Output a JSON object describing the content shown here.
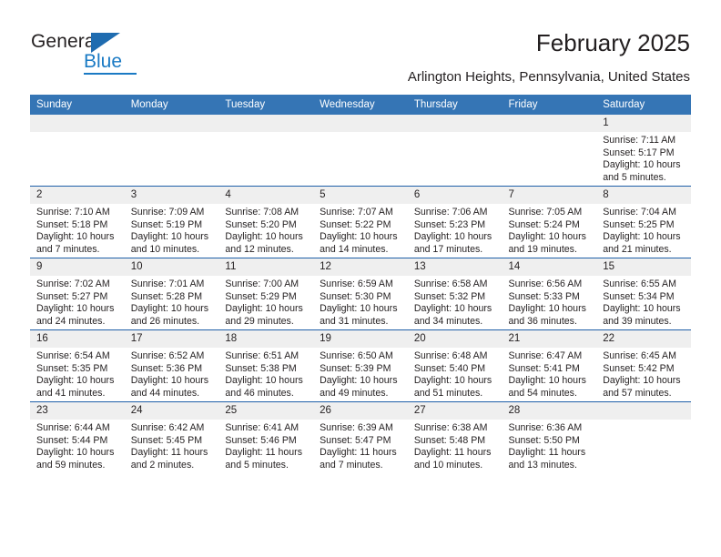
{
  "brand": {
    "name_part1": "General",
    "name_part2": "Blue",
    "triangle_color": "#1f6cb0",
    "blue_color": "#1a7ac4"
  },
  "header": {
    "title": "February 2025",
    "subtitle": "Arlington Heights, Pennsylvania, United States",
    "header_bg": "#3575b5",
    "row_line": "#1f5fa8",
    "daynum_bg": "#efefef"
  },
  "weekday_headers": [
    "Sunday",
    "Monday",
    "Tuesday",
    "Wednesday",
    "Thursday",
    "Friday",
    "Saturday"
  ],
  "labels": {
    "sunrise": "Sunrise:",
    "sunset": "Sunset:",
    "daylight": "Daylight:"
  },
  "weeks": [
    [
      {
        "day": "",
        "blank": true
      },
      {
        "day": "",
        "blank": true
      },
      {
        "day": "",
        "blank": true
      },
      {
        "day": "",
        "blank": true
      },
      {
        "day": "",
        "blank": true
      },
      {
        "day": "",
        "blank": true
      },
      {
        "day": "1",
        "sunrise": "Sunrise: 7:11 AM",
        "sunset": "Sunset: 5:17 PM",
        "daylight1": "Daylight: 10 hours",
        "daylight2": "and 5 minutes."
      }
    ],
    [
      {
        "day": "2",
        "sunrise": "Sunrise: 7:10 AM",
        "sunset": "Sunset: 5:18 PM",
        "daylight1": "Daylight: 10 hours",
        "daylight2": "and 7 minutes."
      },
      {
        "day": "3",
        "sunrise": "Sunrise: 7:09 AM",
        "sunset": "Sunset: 5:19 PM",
        "daylight1": "Daylight: 10 hours",
        "daylight2": "and 10 minutes."
      },
      {
        "day": "4",
        "sunrise": "Sunrise: 7:08 AM",
        "sunset": "Sunset: 5:20 PM",
        "daylight1": "Daylight: 10 hours",
        "daylight2": "and 12 minutes."
      },
      {
        "day": "5",
        "sunrise": "Sunrise: 7:07 AM",
        "sunset": "Sunset: 5:22 PM",
        "daylight1": "Daylight: 10 hours",
        "daylight2": "and 14 minutes."
      },
      {
        "day": "6",
        "sunrise": "Sunrise: 7:06 AM",
        "sunset": "Sunset: 5:23 PM",
        "daylight1": "Daylight: 10 hours",
        "daylight2": "and 17 minutes."
      },
      {
        "day": "7",
        "sunrise": "Sunrise: 7:05 AM",
        "sunset": "Sunset: 5:24 PM",
        "daylight1": "Daylight: 10 hours",
        "daylight2": "and 19 minutes."
      },
      {
        "day": "8",
        "sunrise": "Sunrise: 7:04 AM",
        "sunset": "Sunset: 5:25 PM",
        "daylight1": "Daylight: 10 hours",
        "daylight2": "and 21 minutes."
      }
    ],
    [
      {
        "day": "9",
        "sunrise": "Sunrise: 7:02 AM",
        "sunset": "Sunset: 5:27 PM",
        "daylight1": "Daylight: 10 hours",
        "daylight2": "and 24 minutes."
      },
      {
        "day": "10",
        "sunrise": "Sunrise: 7:01 AM",
        "sunset": "Sunset: 5:28 PM",
        "daylight1": "Daylight: 10 hours",
        "daylight2": "and 26 minutes."
      },
      {
        "day": "11",
        "sunrise": "Sunrise: 7:00 AM",
        "sunset": "Sunset: 5:29 PM",
        "daylight1": "Daylight: 10 hours",
        "daylight2": "and 29 minutes."
      },
      {
        "day": "12",
        "sunrise": "Sunrise: 6:59 AM",
        "sunset": "Sunset: 5:30 PM",
        "daylight1": "Daylight: 10 hours",
        "daylight2": "and 31 minutes."
      },
      {
        "day": "13",
        "sunrise": "Sunrise: 6:58 AM",
        "sunset": "Sunset: 5:32 PM",
        "daylight1": "Daylight: 10 hours",
        "daylight2": "and 34 minutes."
      },
      {
        "day": "14",
        "sunrise": "Sunrise: 6:56 AM",
        "sunset": "Sunset: 5:33 PM",
        "daylight1": "Daylight: 10 hours",
        "daylight2": "and 36 minutes."
      },
      {
        "day": "15",
        "sunrise": "Sunrise: 6:55 AM",
        "sunset": "Sunset: 5:34 PM",
        "daylight1": "Daylight: 10 hours",
        "daylight2": "and 39 minutes."
      }
    ],
    [
      {
        "day": "16",
        "sunrise": "Sunrise: 6:54 AM",
        "sunset": "Sunset: 5:35 PM",
        "daylight1": "Daylight: 10 hours",
        "daylight2": "and 41 minutes."
      },
      {
        "day": "17",
        "sunrise": "Sunrise: 6:52 AM",
        "sunset": "Sunset: 5:36 PM",
        "daylight1": "Daylight: 10 hours",
        "daylight2": "and 44 minutes."
      },
      {
        "day": "18",
        "sunrise": "Sunrise: 6:51 AM",
        "sunset": "Sunset: 5:38 PM",
        "daylight1": "Daylight: 10 hours",
        "daylight2": "and 46 minutes."
      },
      {
        "day": "19",
        "sunrise": "Sunrise: 6:50 AM",
        "sunset": "Sunset: 5:39 PM",
        "daylight1": "Daylight: 10 hours",
        "daylight2": "and 49 minutes."
      },
      {
        "day": "20",
        "sunrise": "Sunrise: 6:48 AM",
        "sunset": "Sunset: 5:40 PM",
        "daylight1": "Daylight: 10 hours",
        "daylight2": "and 51 minutes."
      },
      {
        "day": "21",
        "sunrise": "Sunrise: 6:47 AM",
        "sunset": "Sunset: 5:41 PM",
        "daylight1": "Daylight: 10 hours",
        "daylight2": "and 54 minutes."
      },
      {
        "day": "22",
        "sunrise": "Sunrise: 6:45 AM",
        "sunset": "Sunset: 5:42 PM",
        "daylight1": "Daylight: 10 hours",
        "daylight2": "and 57 minutes."
      }
    ],
    [
      {
        "day": "23",
        "sunrise": "Sunrise: 6:44 AM",
        "sunset": "Sunset: 5:44 PM",
        "daylight1": "Daylight: 10 hours",
        "daylight2": "and 59 minutes."
      },
      {
        "day": "24",
        "sunrise": "Sunrise: 6:42 AM",
        "sunset": "Sunset: 5:45 PM",
        "daylight1": "Daylight: 11 hours",
        "daylight2": "and 2 minutes."
      },
      {
        "day": "25",
        "sunrise": "Sunrise: 6:41 AM",
        "sunset": "Sunset: 5:46 PM",
        "daylight1": "Daylight: 11 hours",
        "daylight2": "and 5 minutes."
      },
      {
        "day": "26",
        "sunrise": "Sunrise: 6:39 AM",
        "sunset": "Sunset: 5:47 PM",
        "daylight1": "Daylight: 11 hours",
        "daylight2": "and 7 minutes."
      },
      {
        "day": "27",
        "sunrise": "Sunrise: 6:38 AM",
        "sunset": "Sunset: 5:48 PM",
        "daylight1": "Daylight: 11 hours",
        "daylight2": "and 10 minutes."
      },
      {
        "day": "28",
        "sunrise": "Sunrise: 6:36 AM",
        "sunset": "Sunset: 5:50 PM",
        "daylight1": "Daylight: 11 hours",
        "daylight2": "and 13 minutes."
      },
      {
        "day": "",
        "blank": true
      }
    ]
  ]
}
